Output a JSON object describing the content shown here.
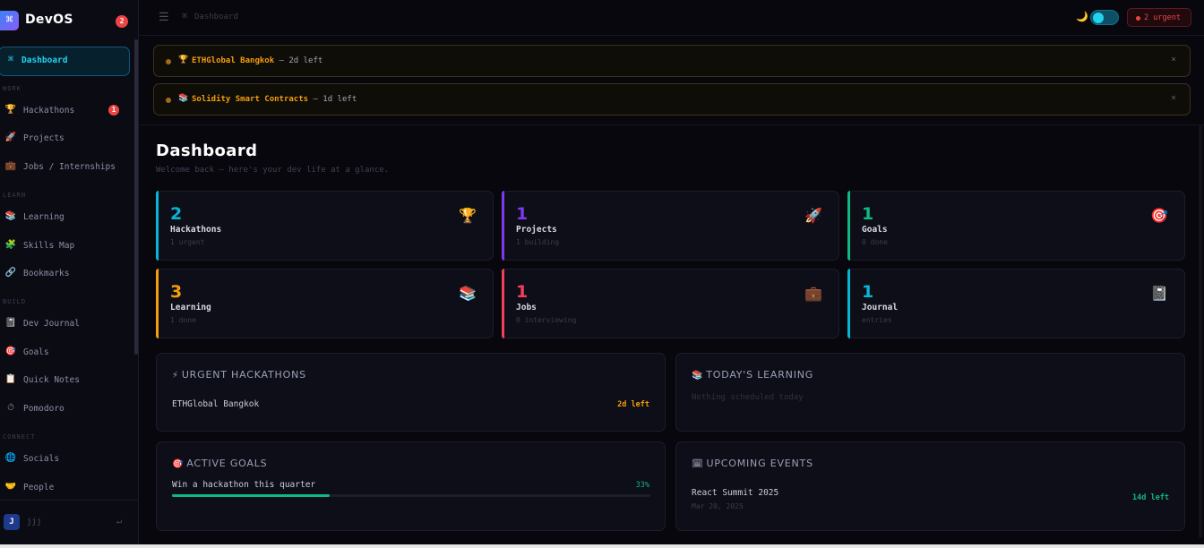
{
  "app": {
    "name": "DevOS",
    "logo_glyph": "⌘",
    "notification_count": "2"
  },
  "sidebar": {
    "active": {
      "icon": "⌘",
      "label": "Dashboard"
    },
    "sections": {
      "work": "WORK",
      "learn": "LEARN",
      "build": "BUILD",
      "connect": "CONNECT"
    },
    "items": {
      "hackathons": {
        "icon": "🏆",
        "label": "Hackathons",
        "badge": "1"
      },
      "projects": {
        "icon": "🚀",
        "label": "Projects"
      },
      "jobs": {
        "icon": "💼",
        "label": "Jobs / Internships"
      },
      "learning": {
        "icon": "📚",
        "label": "Learning"
      },
      "skills": {
        "icon": "🧩",
        "label": "Skills Map"
      },
      "bookmarks": {
        "icon": "🔗",
        "label": "Bookmarks"
      },
      "journal": {
        "icon": "📓",
        "label": "Dev Journal"
      },
      "goals": {
        "icon": "🎯",
        "label": "Goals"
      },
      "notes": {
        "icon": "📋",
        "label": "Quick Notes"
      },
      "pomodoro": {
        "icon": "⏱",
        "label": "Pomodoro"
      },
      "socials": {
        "icon": "🌐",
        "label": "Socials"
      },
      "people": {
        "icon": "🤝",
        "label": "People"
      }
    },
    "user": {
      "initial": "J",
      "name": "jjj",
      "logout_glyph": "↵"
    }
  },
  "topbar": {
    "menu_glyph": "☰",
    "breadcrumb_icon": "⌘",
    "breadcrumb": "Dashboard",
    "theme_icon": "🌙",
    "urgent_label": "2 urgent"
  },
  "alerts": [
    {
      "icon": "🏆",
      "title": "ETHGlobal Bangkok",
      "rest": " — 2d left",
      "close": "×"
    },
    {
      "icon": "📚",
      "title": "Solidity Smart Contracts",
      "rest": " — 1d left",
      "close": "×"
    }
  ],
  "page": {
    "title": "Dashboard",
    "subtitle": "Welcome back — here's your dev life at a glance."
  },
  "stats": [
    {
      "value": "2",
      "label": "Hackathons",
      "sub": "1 urgent",
      "icon": "🏆",
      "color": "#06b6d4"
    },
    {
      "value": "1",
      "label": "Projects",
      "sub": "1 building",
      "icon": "🚀",
      "color": "#7c3aed"
    },
    {
      "value": "1",
      "label": "Goals",
      "sub": "0 done",
      "icon": "🎯",
      "color": "#10b981"
    },
    {
      "value": "3",
      "label": "Learning",
      "sub": "1 done",
      "icon": "📚",
      "color": "#f59e0b"
    },
    {
      "value": "1",
      "label": "Jobs",
      "sub": "0 interviewing",
      "icon": "💼",
      "color": "#f43f5e"
    },
    {
      "value": "1",
      "label": "Journal",
      "sub": "entries",
      "icon": "📓",
      "color": "#06b6d4"
    }
  ],
  "panels": {
    "urgent_hackathons": {
      "icon": "⚡",
      "title": "URGENT HACKATHONS",
      "item": {
        "name": "ETHGlobal Bangkok",
        "left": "2d left"
      }
    },
    "todays_learning": {
      "icon": "📚",
      "title": "TODAY'S LEARNING",
      "empty": "Nothing scheduled today"
    },
    "active_goals": {
      "icon": "🎯",
      "title": "ACTIVE GOALS",
      "goal": {
        "name": "Win a hackathon this quarter",
        "percent_label": "33%",
        "progress": 0.33
      }
    },
    "upcoming_events": {
      "icon": "🗓",
      "title": "UPCOMING EVENTS",
      "event": {
        "name": "React Summit 2025",
        "date": "Mar 20, 2025",
        "left": "14d left"
      }
    }
  },
  "colors": {
    "accent": "#22d3ee",
    "urgent": "#ef4444",
    "warning": "#f59e0b",
    "success": "#10b981"
  }
}
